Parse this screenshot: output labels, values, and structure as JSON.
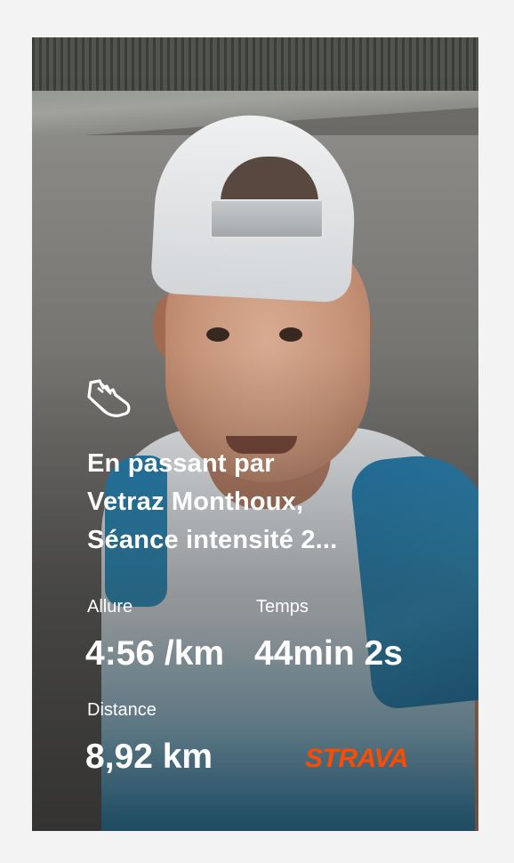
{
  "activity": {
    "sport_icon": "running-shoe-icon",
    "title_lines": [
      "En passant par",
      "Vetraz Monthoux,",
      "Séance intensité 2..."
    ]
  },
  "stats": {
    "pace": {
      "label": "Allure",
      "value": "4:56 /km"
    },
    "time": {
      "label": "Temps",
      "value": "44min 2s"
    },
    "distance": {
      "label": "Distance",
      "value": "8,92 km"
    }
  },
  "brand": {
    "name": "STRAVA",
    "color": "#fc4c02"
  },
  "colors": {
    "page_background": "#f3f3f3",
    "text": "#ffffff"
  }
}
